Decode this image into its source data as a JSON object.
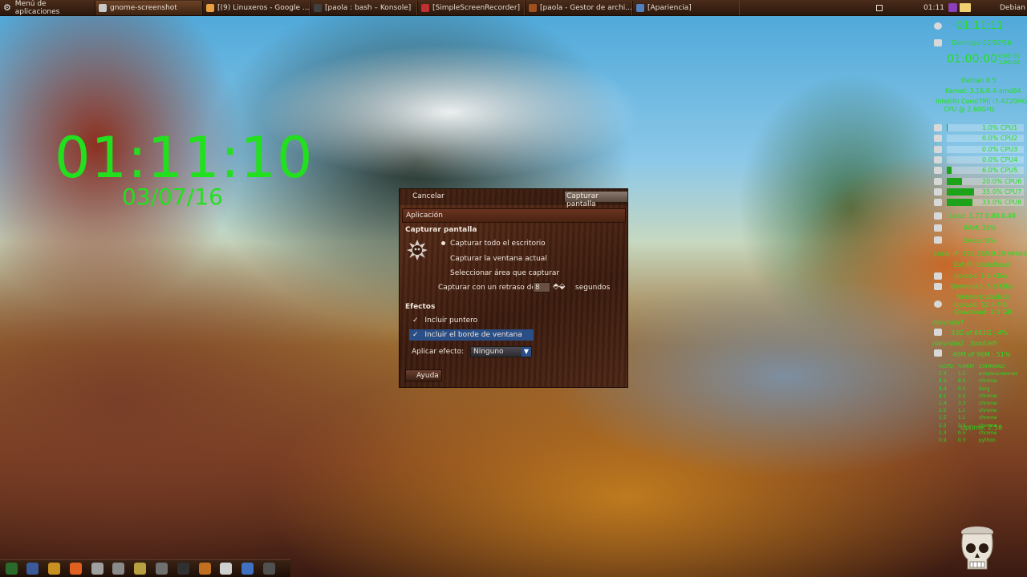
{
  "top_panel": {
    "menu_label": "Menú de aplicaciones",
    "tasks": [
      {
        "label": "gnome-screenshot",
        "color": "#c8c8c8"
      },
      {
        "label": "[(9) Linuxeros - Google ...",
        "color": "#e8a040"
      },
      {
        "label": "[paola : bash – Konsole]",
        "color": "#404040"
      },
      {
        "label": "[SimpleScreenRecorder]",
        "color": "#c03030"
      },
      {
        "label": "[paola - Gestor de archi...",
        "color": "#a05020"
      },
      {
        "label": "[Apariencia]",
        "color": "#5080c0"
      }
    ],
    "clock": "01:11",
    "distro": "Debian"
  },
  "desktop_clock": {
    "time": "01:11:10",
    "date": "03/07/16",
    "color": "#22e01e"
  },
  "dialog": {
    "cancel_label": "Cancelar",
    "capture_label": "Capturar pantalla",
    "app_bar_label": "Aplicación",
    "capture_section": "Capturar pantalla",
    "options": [
      {
        "label": "Capturar todo el escritorio",
        "selected": true
      },
      {
        "label": "Capturar la ventana actual",
        "selected": false
      },
      {
        "label": "Seleccionar área que capturar",
        "selected": false
      }
    ],
    "delay_label": "Capturar con un retraso de",
    "delay_value": "8",
    "delay_unit": "segundos",
    "effects_section": "Efectos",
    "include_pointer": "Incluir puntero",
    "include_border": "Incluir el borde de ventana",
    "effect_label": "Aplicar efecto:",
    "effect_value": "Ninguno",
    "help_label": "Ayuda"
  },
  "conky": {
    "time": "01:11:11",
    "date_line": "Domingo 03/07/16",
    "timer": "01:00:00",
    "timer_side": "0:00:00\n1:00:00",
    "distro": "Debian 8.5",
    "kernel": "Kernel: 3.16.0-4-amd64",
    "cpu_model": "Intel(R) Core(TM) i7-4720HQ",
    "cpu_freq": "CPU @ 2.60GHz",
    "cpu_rows": [
      {
        "label": "1.0% CPU1",
        "fill": 0.01
      },
      {
        "label": "0.0% CPU2",
        "fill": 0.0
      },
      {
        "label": "0.0% CPU3",
        "fill": 0.0
      },
      {
        "label": "0.0% CPU4",
        "fill": 0.0
      },
      {
        "label": "6.0% CPU5",
        "fill": 0.06
      },
      {
        "label": "20.0% CPU6",
        "fill": 0.2
      },
      {
        "label": "35.0% CPU7",
        "fill": 0.35
      },
      {
        "label": "33.0% CPU8",
        "fill": 0.33
      }
    ],
    "load": "Load: 1.77 0.80 0.48",
    "ram": "RAM: 25%",
    "swap": "Swap: 0%",
    "local_ip": "Local IP: 192.168.0.19 (wlan0)",
    "ext_ip": "Ext IP: Undefined",
    "upload": "Upload: 1.6 KB/s",
    "download": "Download: 5.8 KB/s",
    "net_stat": "Network statistic",
    "upload_total": "Upload: 92.4 MB",
    "download_total": "Download: 1.9 GB",
    "disk1": "/dev/sda7",
    "disk1_usage": "33G of 882G : 4%",
    "disk2": "/dev/sda2",
    "disk2_mount": "/boot/efi",
    "disk2_usage": "49M of 96M : 51%",
    "proc_header": [
      "%CPU",
      "%MEM",
      "COMMAND"
    ],
    "processes": [
      [
        "1.4",
        "1.1",
        "simplescreenrec"
      ],
      [
        "4.4",
        "8.0",
        "chrome"
      ],
      [
        "4.4",
        "0.5",
        "Xorg"
      ],
      [
        "4.1",
        "2.2",
        "chrome"
      ],
      [
        "1.4",
        "3.3",
        "chrome"
      ],
      [
        "1.5",
        "1.1",
        "chrome"
      ],
      [
        "1.5",
        "1.1",
        "chrome"
      ],
      [
        "1.2",
        "2.2",
        "chrome"
      ],
      [
        "1.3",
        "0.5",
        "chrome"
      ],
      [
        "0.9",
        "0.3",
        "python"
      ]
    ],
    "uptime": "Uptime: 2:58"
  },
  "dock": {
    "items": [
      {
        "name": "system-monitor-icon",
        "color": "#2a6a2a"
      },
      {
        "name": "settings-icon",
        "color": "#3a5a9a"
      },
      {
        "name": "network-icon",
        "color": "#c89020"
      },
      {
        "name": "firefox-icon",
        "color": "#e06020"
      },
      {
        "name": "bottle-icon",
        "color": "#a0a0a0"
      },
      {
        "name": "screenshot-icon",
        "color": "#8a8a8a"
      },
      {
        "name": "image-viewer-icon",
        "color": "#b8a040"
      },
      {
        "name": "scissors-icon",
        "color": "#707070"
      },
      {
        "name": "terminal-icon",
        "color": "#303030"
      },
      {
        "name": "media-icon",
        "color": "#c07020"
      },
      {
        "name": "diamond-icon",
        "color": "#d0d0d0"
      },
      {
        "name": "appearance-icon",
        "color": "#4070c0"
      },
      {
        "name": "power-icon",
        "color": "#505050"
      }
    ]
  }
}
